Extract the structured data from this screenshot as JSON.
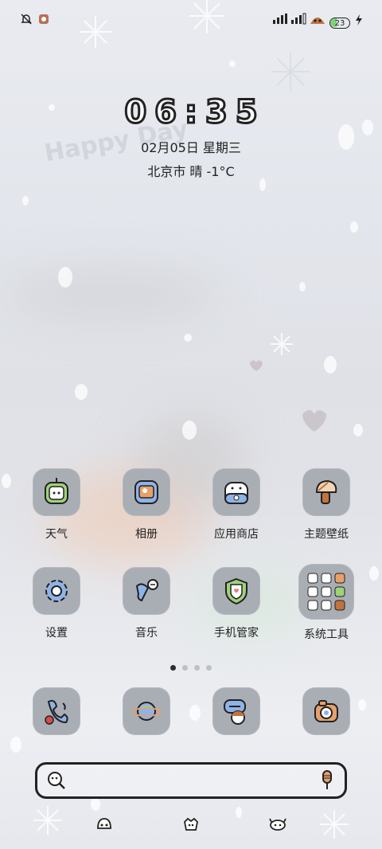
{
  "status_bar": {
    "left_icons": [
      "bell-muted-icon",
      "app-notification-icon"
    ],
    "right_icons": [
      "signal-1-icon",
      "signal-2-icon",
      "wifi-cat-icon"
    ],
    "battery": "23",
    "charging_icon": "lightning-icon"
  },
  "clock": {
    "time": "06:35",
    "date": "02月05日 星期三",
    "weather": "北京市 晴 -1°C"
  },
  "wallpaper_text": "Happy Day",
  "apps": [
    {
      "label": "天气",
      "icon": "weather-icon"
    },
    {
      "label": "相册",
      "icon": "gallery-icon"
    },
    {
      "label": "应用商店",
      "icon": "app-store-icon"
    },
    {
      "label": "主题壁纸",
      "icon": "theme-icon"
    },
    {
      "label": "设置",
      "icon": "settings-gear-icon"
    },
    {
      "label": "音乐",
      "icon": "music-icon"
    },
    {
      "label": "手机管家",
      "icon": "phone-manager-icon"
    },
    {
      "label": "系统工具",
      "icon": "system-tools-folder-icon"
    }
  ],
  "page_indicator": {
    "count": 4,
    "active": 1
  },
  "dock": [
    "phone-icon",
    "browser-planet-icon",
    "messages-icon",
    "camera-icon"
  ],
  "search_bar": {
    "left_icon": "search-face-icon",
    "right_icon": "microphone-icon"
  },
  "bottom_nav": [
    "nav-left-icon",
    "nav-home-icon",
    "nav-right-icon"
  ],
  "colors": {
    "icon_bg": "#a9adb4",
    "text": "#222222",
    "accent_blue": "#8fb3e6"
  }
}
